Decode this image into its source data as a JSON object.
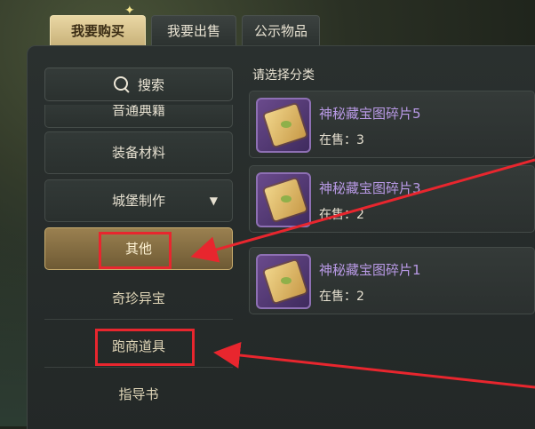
{
  "tabs": [
    {
      "label": "我要购买",
      "active": true
    },
    {
      "label": "我要出售",
      "active": false
    },
    {
      "label": "公示物品",
      "active": false
    }
  ],
  "sidebar": {
    "search_label": "搜索",
    "items": [
      {
        "label": "音通典籍",
        "partial": true
      },
      {
        "label": "装备材料"
      },
      {
        "label": "城堡制作",
        "has_caret": true
      },
      {
        "label": "其他",
        "active": true
      },
      {
        "label": "奇珍异宝",
        "sub": true
      },
      {
        "label": "跑商道具",
        "sub": true
      },
      {
        "label": "指导书",
        "sub": true
      }
    ]
  },
  "content": {
    "title": "请选择分类",
    "items": [
      {
        "name": "神秘藏宝图碎片5",
        "stock": "在售：3"
      },
      {
        "name": "神秘藏宝图碎片3",
        "stock": "在售：2"
      },
      {
        "name": "神秘藏宝图碎片1",
        "stock": "在售：2"
      }
    ]
  },
  "colors": {
    "accent_gold": "#c9ad6e",
    "annotation_red": "#e8262e",
    "item_name_purple": "#b99ae6"
  }
}
